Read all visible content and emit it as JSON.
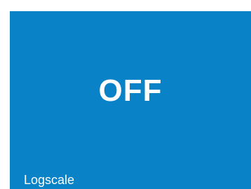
{
  "tile": {
    "state_text": "OFF",
    "label": "Logscale",
    "background_color": "#0a82c8",
    "text_color": "#ffffff"
  }
}
